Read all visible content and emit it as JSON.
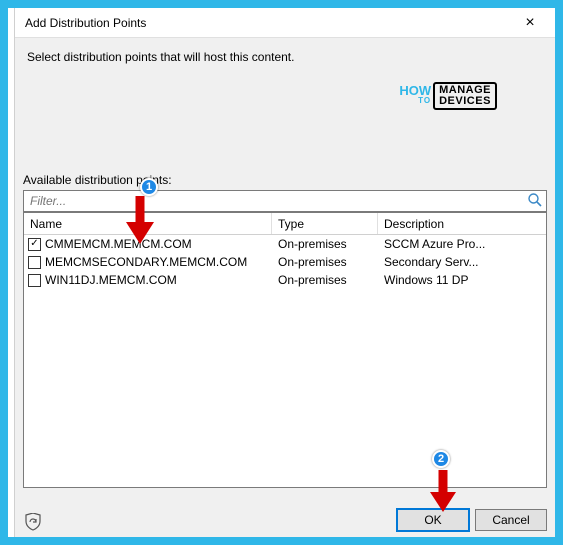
{
  "dialog": {
    "title": "Add Distribution Points",
    "close_glyph": "×",
    "instruction": "Select distribution points that will host this content."
  },
  "available_label": "Available distribution points:",
  "filter": {
    "placeholder": "Filter..."
  },
  "columns": {
    "name": "Name",
    "type": "Type",
    "desc": "Description"
  },
  "rows": [
    {
      "checked": true,
      "name": "CMMEMCM.MEMCM.COM",
      "type": "On-premises",
      "desc": "SCCM Azure Pro..."
    },
    {
      "checked": false,
      "name": "MEMCMSECONDARY.MEMCM.COM",
      "type": "On-premises",
      "desc": "Secondary Serv..."
    },
    {
      "checked": false,
      "name": "WIN11DJ.MEMCM.COM",
      "type": "On-premises",
      "desc": "Windows 11 DP"
    }
  ],
  "buttons": {
    "ok": "OK",
    "cancel": "Cancel"
  },
  "watermark": {
    "how": "HOW",
    "to": "TO",
    "line1": "MANAGE",
    "line2": "DEVICES"
  },
  "annotations": {
    "badge1": "1",
    "badge2": "2"
  }
}
